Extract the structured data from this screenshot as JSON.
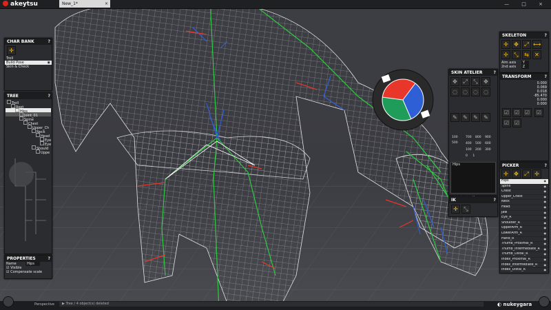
{
  "app": {
    "logo_text": "akeytsu",
    "tab_title": "New_1*",
    "tab_close": "×",
    "window_controls": "— □ ×",
    "brand_footer": "nukeygara"
  },
  "colors": {
    "accent_yellow": "#f6c21a",
    "wire": "#ffffff",
    "bone_green": "#2ecc40",
    "axis_red": "#e8362b",
    "axis_blue": "#2f5fd6",
    "logo_red": "#e0231b"
  },
  "charbank": {
    "title": "CHAR BANK",
    "help": "?",
    "items": [
      "Troll",
      "Build Pose",
      "Skin & Check"
    ]
  },
  "tree": {
    "title": "TREE",
    "help": "?",
    "items": [
      "Troll",
      "Root",
      "Hips",
      "Joint_01",
      "Spine",
      "Chest",
      "Upper_Ch",
      "Neck",
      "Head",
      "Eye",
      "Eye",
      "Should",
      "Uppe"
    ]
  },
  "properties": {
    "title": "PROPERTIES",
    "help": "?",
    "name_label": "Name",
    "name_value": "Hips",
    "visible_label": "Visible",
    "compensate_label": "Compensate scale"
  },
  "skin_atelier": {
    "title": "SKIN ATELIER",
    "help": "?",
    "values_row1": [
      "100",
      "700",
      "800",
      "900"
    ],
    "values_row2": [
      "400",
      "500",
      "600"
    ],
    "values_row3": [
      "100",
      "200",
      "300"
    ],
    "values_row4": [
      "0",
      "1"
    ],
    "side_value": "500",
    "list_item": "Hips"
  },
  "ik": {
    "title": "IK",
    "help": "?"
  },
  "skeleton": {
    "title": "SKELETON",
    "help": "?",
    "aim_axis_label": "Aim axis",
    "aim_axis_value": "Y",
    "second_axis_label": "2nd axis",
    "second_axis_value": "Z"
  },
  "transform": {
    "title": "TRANSFORM",
    "help": "?",
    "values": [
      "0.000",
      "0.069",
      "0.018",
      "-85.470",
      "0.000",
      "0.000"
    ]
  },
  "picker": {
    "title": "PICKER",
    "help": "?",
    "items": [
      "Hips",
      "Spine",
      "Chest",
      "Upper_Chest",
      "Neck",
      "Head",
      "Jaw",
      "Eye_R",
      "Shoulder_R",
      "UpperArm_R",
      "LowerArm_R",
      "Hand_R",
      "Thumb_Proximal_R",
      "Thumb_Intermediate_R",
      "Thumb_Distal_R",
      "Index_Proximal_R",
      "Index_Intermediate_R",
      "Index_Distal_R",
      "Middle_Proximal_R",
      "Middle_Intermediate_R",
      "Middle_Distal_R"
    ]
  },
  "status": {
    "camera": "Perspective",
    "message": "Tree / 4 object(s) deleted"
  }
}
